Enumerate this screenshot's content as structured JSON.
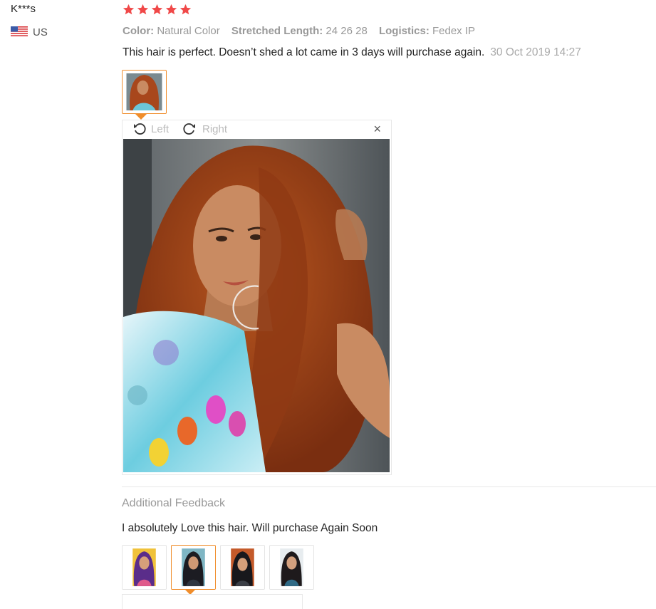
{
  "review": {
    "user": "K***s",
    "country": "US",
    "rating": 5,
    "attributes": [
      {
        "key": "Color:",
        "value": "Natural Color"
      },
      {
        "key": "Stretched Length:",
        "value": "24 26 28"
      },
      {
        "key": "Logistics:",
        "value": "Fedex IP"
      }
    ],
    "text": "This hair is perfect. Doesn’t shed a lot came in 3 days will purchase again.",
    "date": "30 Oct 2019 14:27"
  },
  "viewer": {
    "rotate_left": "Left",
    "rotate_right": "Right",
    "close": "×"
  },
  "additional": {
    "title": "Additional Feedback",
    "text": "I absolutely Love this hair. Will purchase Again Soon"
  },
  "colors": {
    "star": "#f04848",
    "accent": "#f08d2b",
    "hair": "#a8471c",
    "skin": "#c98b62"
  }
}
